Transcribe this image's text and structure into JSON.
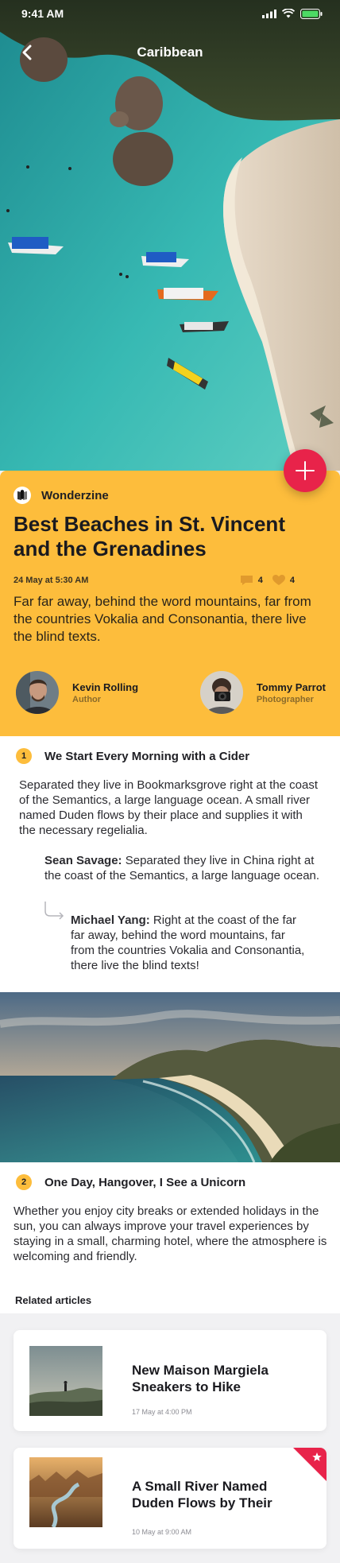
{
  "status": {
    "time": "9:41 AM"
  },
  "nav": {
    "title": "Caribbean"
  },
  "brand": {
    "name": "Wonderzine"
  },
  "article": {
    "headline": "Best Beaches in St. Vincent and the Grenadines",
    "date": "24 May at 5:30 AM",
    "comments": "4",
    "likes": "4",
    "lead": "Far far away, behind the word mountains, far from the countries Vokalia and Consonantia, there live the blind texts."
  },
  "people": [
    {
      "name": "Kevin Rolling",
      "role": "Author"
    },
    {
      "name": "Tommy Parrot",
      "role": "Photographer"
    }
  ],
  "sections": [
    {
      "number": "1",
      "title": "We Start Every Morning with a Cider",
      "text": "Separated they live in Bookmarksgrove right at the coast of the Semantics, a large language ocean. A small river named Duden flows by their place and supplies it with the necessary regelialia."
    },
    {
      "number": "2",
      "title": "One Day, Hangover, I See a Unicorn",
      "text": "Whether you enjoy city breaks or extended holidays in the sun, you can always improve your travel experiences by staying in a small, charming hotel, where the atmosphere is welcoming and friendly."
    }
  ],
  "comments": [
    {
      "author": "Sean Savage:",
      "text": " Separated they live in China right at the coast of the Semantics, a large language ocean."
    },
    {
      "author": "Michael Yang:",
      "text": " Right at the coast of the far far away, behind the word mountains, far from the countries Vokalia and Consonantia, there live the blind texts!"
    }
  ],
  "related": {
    "label": "Related articles",
    "items": [
      {
        "title": "New Maison Margiela Sneakers to Hike",
        "date": "17 May at 4:00 PM",
        "bookmarked": false
      },
      {
        "title": "A Small River Named Duden Flows by Their",
        "date": "10 May at 9:00 AM",
        "bookmarked": true
      }
    ]
  },
  "colors": {
    "accent": "#fdbd3c",
    "fab": "#e8234a",
    "bookmark": "#e8234a"
  },
  "icons": [
    "back-chevron-icon",
    "plus-icon",
    "comment-icon",
    "heart-icon",
    "reply-arrow-icon",
    "star-icon",
    "signal-icon",
    "wifi-icon",
    "battery-icon"
  ]
}
